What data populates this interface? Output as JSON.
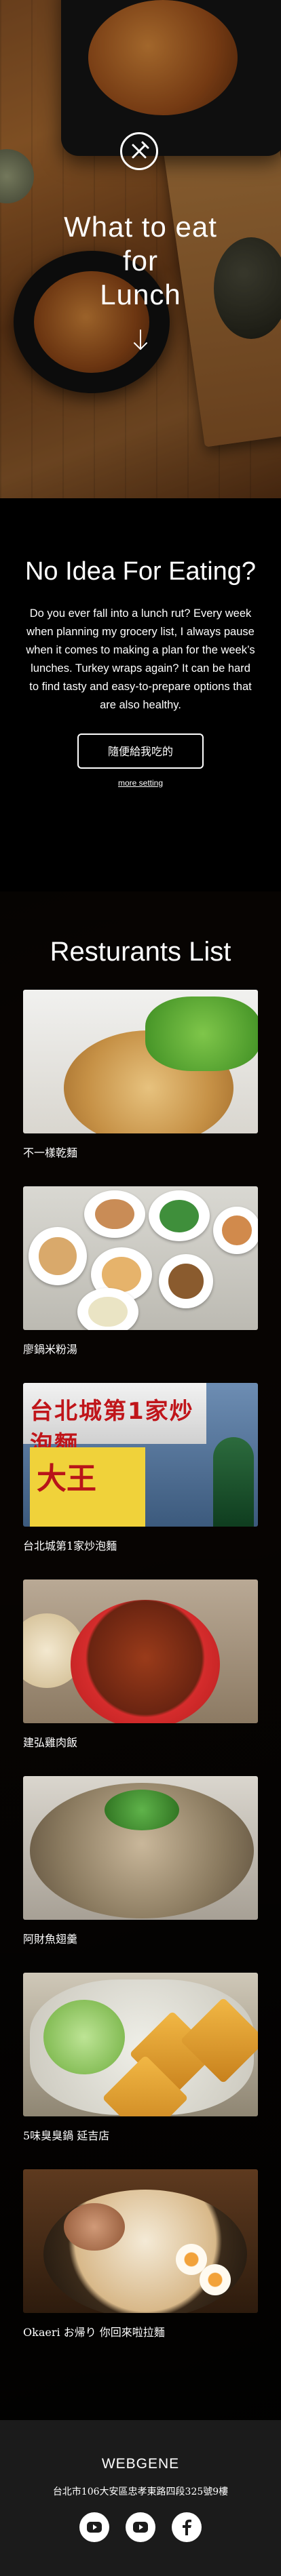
{
  "hero": {
    "title_lines": [
      "What to eat",
      "for",
      "Lunch"
    ],
    "logo_icon": "fork-knife-icon",
    "scroll_icon": "arrow-down-icon"
  },
  "intro": {
    "heading": "No Idea For Eating?",
    "body": "Do you ever fall into a lunch rut? Every week when planning my grocery list, I always pause when it comes to making a plan for the week’s lunches. Turkey wraps again? It can be hard to find tasty and easy-to-prepare options that are also healthy.",
    "random_button": "隨便給我吃的",
    "more_setting": "more setting"
  },
  "restaurants": {
    "heading": "Resturants List",
    "items": [
      {
        "name": "不一樣乾麵"
      },
      {
        "name": "廖鍋米粉湯"
      },
      {
        "name": "台北城第1家炒泡麵"
      },
      {
        "name": "建弘雞肉飯"
      },
      {
        "name": "阿財魚翅羹"
      },
      {
        "name": "5味臭臭鍋 延吉店"
      },
      {
        "name": "Okaeri お帰り 你回來啦拉麵"
      }
    ],
    "sign_texts": {
      "banner": "台北城第1家炒泡麵",
      "yellow": "大王"
    }
  },
  "footer": {
    "brand": "WEBGENE",
    "address": "台北市106大安區忠孝東路四段325號9樓",
    "social_icons": [
      "youtube-icon",
      "youtube-icon",
      "facebook-icon"
    ]
  }
}
